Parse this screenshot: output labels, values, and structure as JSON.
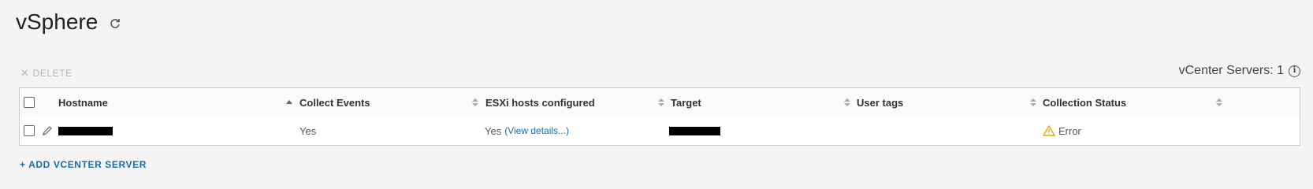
{
  "page": {
    "title": "vSphere"
  },
  "toolbar": {
    "delete_label": "DELETE",
    "vcenter_count_label": "vCenter Servers: 1",
    "info_glyph": "i"
  },
  "table": {
    "columns": [
      "Hostname",
      "Collect Events",
      "ESXi hosts configured",
      "Target",
      "User tags",
      "Collection Status"
    ],
    "rows": [
      {
        "hostname": "",
        "collect_events": "Yes",
        "esxi_configured": "Yes",
        "esxi_link": "(View details...)",
        "target": "",
        "user_tags": "",
        "status": "Error"
      }
    ]
  },
  "footer": {
    "add_label": "+ ADD VCENTER SERVER"
  },
  "colors": {
    "accent": "#1a6ea8",
    "warning": "#e6a700",
    "redaction": "#000000"
  }
}
